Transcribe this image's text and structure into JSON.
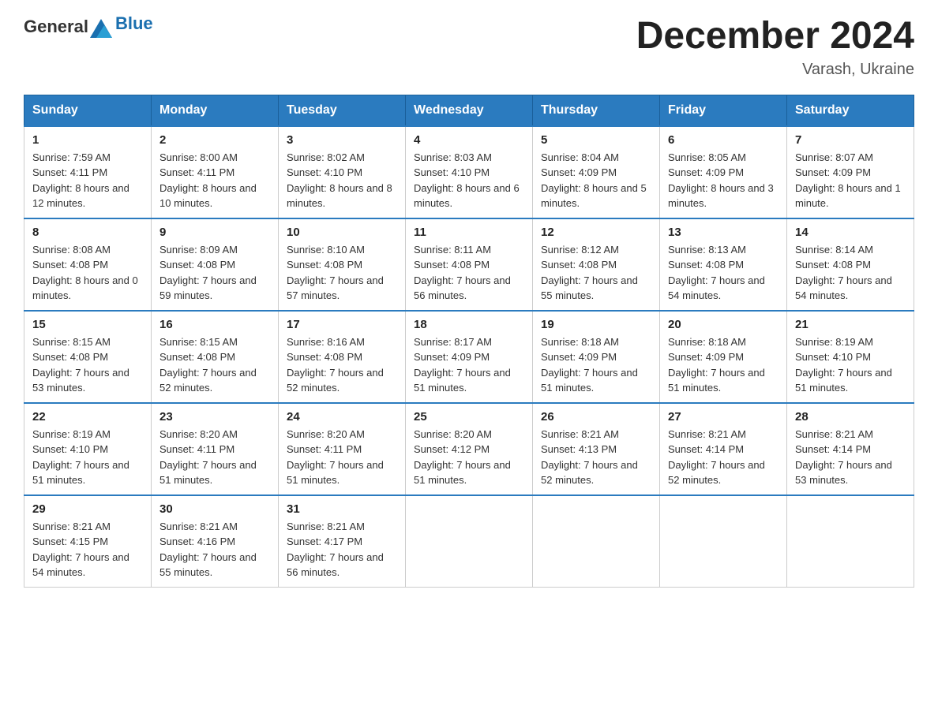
{
  "header": {
    "logo_general": "General",
    "logo_blue": "Blue",
    "month_title": "December 2024",
    "location": "Varash, Ukraine"
  },
  "days_of_week": [
    "Sunday",
    "Monday",
    "Tuesday",
    "Wednesday",
    "Thursday",
    "Friday",
    "Saturday"
  ],
  "weeks": [
    [
      {
        "day": "1",
        "sunrise": "7:59 AM",
        "sunset": "4:11 PM",
        "daylight": "8 hours and 12 minutes."
      },
      {
        "day": "2",
        "sunrise": "8:00 AM",
        "sunset": "4:11 PM",
        "daylight": "8 hours and 10 minutes."
      },
      {
        "day": "3",
        "sunrise": "8:02 AM",
        "sunset": "4:10 PM",
        "daylight": "8 hours and 8 minutes."
      },
      {
        "day": "4",
        "sunrise": "8:03 AM",
        "sunset": "4:10 PM",
        "daylight": "8 hours and 6 minutes."
      },
      {
        "day": "5",
        "sunrise": "8:04 AM",
        "sunset": "4:09 PM",
        "daylight": "8 hours and 5 minutes."
      },
      {
        "day": "6",
        "sunrise": "8:05 AM",
        "sunset": "4:09 PM",
        "daylight": "8 hours and 3 minutes."
      },
      {
        "day": "7",
        "sunrise": "8:07 AM",
        "sunset": "4:09 PM",
        "daylight": "8 hours and 1 minute."
      }
    ],
    [
      {
        "day": "8",
        "sunrise": "8:08 AM",
        "sunset": "4:08 PM",
        "daylight": "8 hours and 0 minutes."
      },
      {
        "day": "9",
        "sunrise": "8:09 AM",
        "sunset": "4:08 PM",
        "daylight": "7 hours and 59 minutes."
      },
      {
        "day": "10",
        "sunrise": "8:10 AM",
        "sunset": "4:08 PM",
        "daylight": "7 hours and 57 minutes."
      },
      {
        "day": "11",
        "sunrise": "8:11 AM",
        "sunset": "4:08 PM",
        "daylight": "7 hours and 56 minutes."
      },
      {
        "day": "12",
        "sunrise": "8:12 AM",
        "sunset": "4:08 PM",
        "daylight": "7 hours and 55 minutes."
      },
      {
        "day": "13",
        "sunrise": "8:13 AM",
        "sunset": "4:08 PM",
        "daylight": "7 hours and 54 minutes."
      },
      {
        "day": "14",
        "sunrise": "8:14 AM",
        "sunset": "4:08 PM",
        "daylight": "7 hours and 54 minutes."
      }
    ],
    [
      {
        "day": "15",
        "sunrise": "8:15 AM",
        "sunset": "4:08 PM",
        "daylight": "7 hours and 53 minutes."
      },
      {
        "day": "16",
        "sunrise": "8:15 AM",
        "sunset": "4:08 PM",
        "daylight": "7 hours and 52 minutes."
      },
      {
        "day": "17",
        "sunrise": "8:16 AM",
        "sunset": "4:08 PM",
        "daylight": "7 hours and 52 minutes."
      },
      {
        "day": "18",
        "sunrise": "8:17 AM",
        "sunset": "4:09 PM",
        "daylight": "7 hours and 51 minutes."
      },
      {
        "day": "19",
        "sunrise": "8:18 AM",
        "sunset": "4:09 PM",
        "daylight": "7 hours and 51 minutes."
      },
      {
        "day": "20",
        "sunrise": "8:18 AM",
        "sunset": "4:09 PM",
        "daylight": "7 hours and 51 minutes."
      },
      {
        "day": "21",
        "sunrise": "8:19 AM",
        "sunset": "4:10 PM",
        "daylight": "7 hours and 51 minutes."
      }
    ],
    [
      {
        "day": "22",
        "sunrise": "8:19 AM",
        "sunset": "4:10 PM",
        "daylight": "7 hours and 51 minutes."
      },
      {
        "day": "23",
        "sunrise": "8:20 AM",
        "sunset": "4:11 PM",
        "daylight": "7 hours and 51 minutes."
      },
      {
        "day": "24",
        "sunrise": "8:20 AM",
        "sunset": "4:11 PM",
        "daylight": "7 hours and 51 minutes."
      },
      {
        "day": "25",
        "sunrise": "8:20 AM",
        "sunset": "4:12 PM",
        "daylight": "7 hours and 51 minutes."
      },
      {
        "day": "26",
        "sunrise": "8:21 AM",
        "sunset": "4:13 PM",
        "daylight": "7 hours and 52 minutes."
      },
      {
        "day": "27",
        "sunrise": "8:21 AM",
        "sunset": "4:14 PM",
        "daylight": "7 hours and 52 minutes."
      },
      {
        "day": "28",
        "sunrise": "8:21 AM",
        "sunset": "4:14 PM",
        "daylight": "7 hours and 53 minutes."
      }
    ],
    [
      {
        "day": "29",
        "sunrise": "8:21 AM",
        "sunset": "4:15 PM",
        "daylight": "7 hours and 54 minutes."
      },
      {
        "day": "30",
        "sunrise": "8:21 AM",
        "sunset": "4:16 PM",
        "daylight": "7 hours and 55 minutes."
      },
      {
        "day": "31",
        "sunrise": "8:21 AM",
        "sunset": "4:17 PM",
        "daylight": "7 hours and 56 minutes."
      },
      null,
      null,
      null,
      null
    ]
  ],
  "labels": {
    "sunrise": "Sunrise:",
    "sunset": "Sunset:",
    "daylight": "Daylight:"
  },
  "colors": {
    "header_bg": "#2b7bbf",
    "border": "#ccc",
    "row_border": "#2b7bbf"
  }
}
